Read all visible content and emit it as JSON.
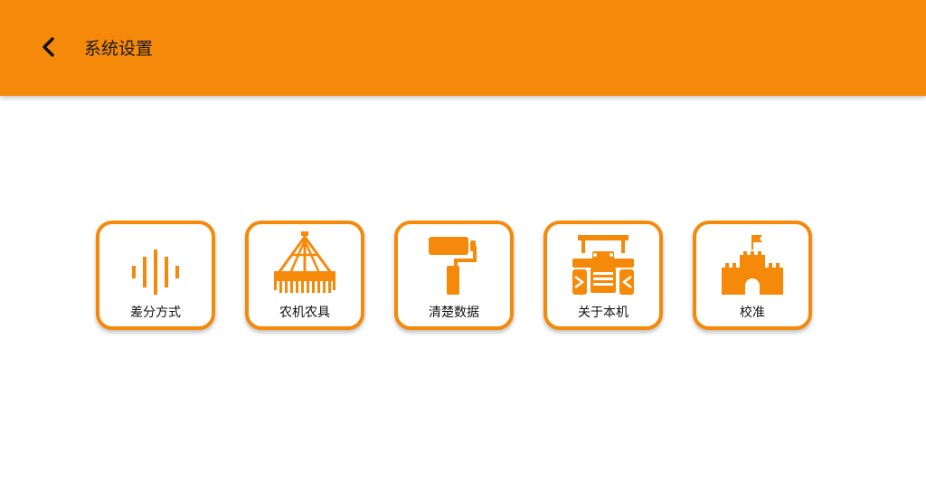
{
  "header": {
    "title": "系统设置",
    "back_icon": "chevron-left-icon"
  },
  "colors": {
    "accent": "#f5890a",
    "background": "#ffffff",
    "text": "#111111"
  },
  "menu": {
    "items": [
      {
        "label": "差分方式",
        "icon": "sound-wave-icon"
      },
      {
        "label": "农机农具",
        "icon": "farm-implement-icon"
      },
      {
        "label": "清楚数据",
        "icon": "paint-roller-icon"
      },
      {
        "label": "关于本机",
        "icon": "tractor-icon"
      },
      {
        "label": "校准",
        "icon": "castle-icon"
      }
    ]
  }
}
